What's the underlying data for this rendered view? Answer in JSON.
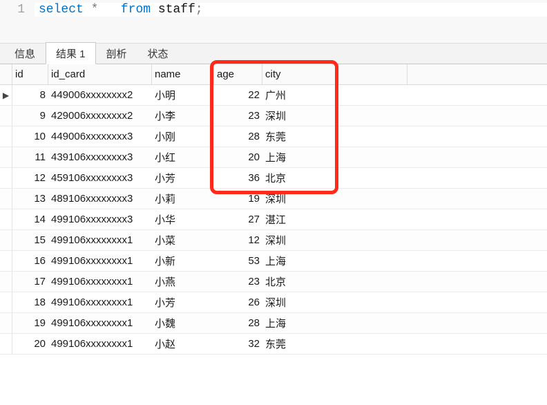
{
  "editor": {
    "line_number": "1",
    "kw_select": "select",
    "sym_star": "*",
    "kw_from": "from",
    "ident_table": "staff",
    "sym_semi": ";"
  },
  "tabs": {
    "info": "信息",
    "result": "结果 1",
    "profile": "剖析",
    "status": "状态"
  },
  "columns": {
    "id": "id",
    "id_card": "id_card",
    "name": "name",
    "age": "age",
    "city": "city"
  },
  "rows": [
    {
      "id": "8",
      "id_card": "449006xxxxxxxx2",
      "name": "小明",
      "age": "22",
      "city": "广州",
      "selected": true
    },
    {
      "id": "9",
      "id_card": "429006xxxxxxxx2",
      "name": "小李",
      "age": "23",
      "city": "深圳"
    },
    {
      "id": "10",
      "id_card": "449006xxxxxxxx3",
      "name": "小刚",
      "age": "28",
      "city": "东莞"
    },
    {
      "id": "11",
      "id_card": "439106xxxxxxxx3",
      "name": "小红",
      "age": "20",
      "city": "上海"
    },
    {
      "id": "12",
      "id_card": "459106xxxxxxxx3",
      "name": "小芳",
      "age": "36",
      "city": "北京"
    },
    {
      "id": "13",
      "id_card": "489106xxxxxxxx3",
      "name": "小莉",
      "age": "19",
      "city": "深圳"
    },
    {
      "id": "14",
      "id_card": "499106xxxxxxxx3",
      "name": "小华",
      "age": "27",
      "city": "湛江"
    },
    {
      "id": "15",
      "id_card": "499106xxxxxxxx1",
      "name": "小菜",
      "age": "12",
      "city": "深圳"
    },
    {
      "id": "16",
      "id_card": "499106xxxxxxxx1",
      "name": "小新",
      "age": "53",
      "city": "上海"
    },
    {
      "id": "17",
      "id_card": "499106xxxxxxxx1",
      "name": "小燕",
      "age": "23",
      "city": "北京"
    },
    {
      "id": "18",
      "id_card": "499106xxxxxxxx1",
      "name": "小芳",
      "age": "26",
      "city": "深圳"
    },
    {
      "id": "19",
      "id_card": "499106xxxxxxxx1",
      "name": "小魏",
      "age": "28",
      "city": "上海"
    },
    {
      "id": "20",
      "id_card": "499106xxxxxxxx1",
      "name": "小赵",
      "age": "32",
      "city": "东莞"
    }
  ]
}
